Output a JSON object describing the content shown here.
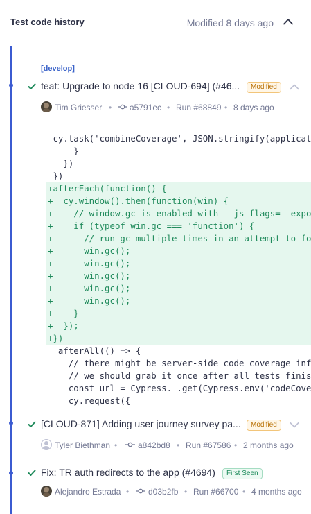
{
  "header": {
    "title": "Test code history",
    "modified": "Modified 8 days ago"
  },
  "branch": "[develop]",
  "commits": [
    {
      "title": "feat: Upgrade to node 16 [CLOUD-694] (#46...",
      "badge": "Modified",
      "author": "Tim Griesser",
      "sha": "a5791ec",
      "run": "Run #68849",
      "time": "8 days ago"
    },
    {
      "title": "[CLOUD-871] Adding user journey survey pa...",
      "badge": "Modified",
      "author": "Tyler Biethman",
      "sha": "a842bd8",
      "run": "Run #67586",
      "time": "2 months ago"
    },
    {
      "title": "Fix: TR auth redirects to the app (#4694)",
      "badge": "First Seen",
      "author": "Alejandro Estrada",
      "sha": "d03b2fb",
      "run": "Run #66700",
      "time": "4 months ago"
    }
  ],
  "code_lines": [
    {
      "added": false,
      "text": " cy.task('combineCoverage', JSON.stringify(applicati"
    },
    {
      "added": false,
      "text": "     }"
    },
    {
      "added": false,
      "text": "   })"
    },
    {
      "added": false,
      "text": " })"
    },
    {
      "added": true,
      "text": "+afterEach(function() {"
    },
    {
      "added": true,
      "text": "+  cy.window().then(function(win) {"
    },
    {
      "added": true,
      "text": "+    // window.gc is enabled with --js-flags=--expo"
    },
    {
      "added": true,
      "text": "+    if (typeof win.gc === 'function') {"
    },
    {
      "added": true,
      "text": "+      // run gc multiple times in an attempt to fo"
    },
    {
      "added": true,
      "text": "+      win.gc();"
    },
    {
      "added": true,
      "text": "+      win.gc();"
    },
    {
      "added": true,
      "text": "+      win.gc();"
    },
    {
      "added": true,
      "text": "+      win.gc();"
    },
    {
      "added": true,
      "text": "+      win.gc();"
    },
    {
      "added": true,
      "text": "+    }"
    },
    {
      "added": true,
      "text": "+  });"
    },
    {
      "added": true,
      "text": "+})"
    },
    {
      "added": false,
      "text": "  afterAll(() => {"
    },
    {
      "added": false,
      "text": "    // there might be server-side code coverage info"
    },
    {
      "added": false,
      "text": "    // we should grab it once after all tests finish"
    },
    {
      "added": false,
      "text": "    const url = Cypress._.get(Cypress.env('codeCover"
    },
    {
      "added": false,
      "text": "    cy.request({"
    }
  ],
  "colors": {
    "accent": "#3b5bd1",
    "added_bg": "#e5f7ee",
    "added_text": "#1f8a5b",
    "pass_check": "#1f8a5b"
  }
}
